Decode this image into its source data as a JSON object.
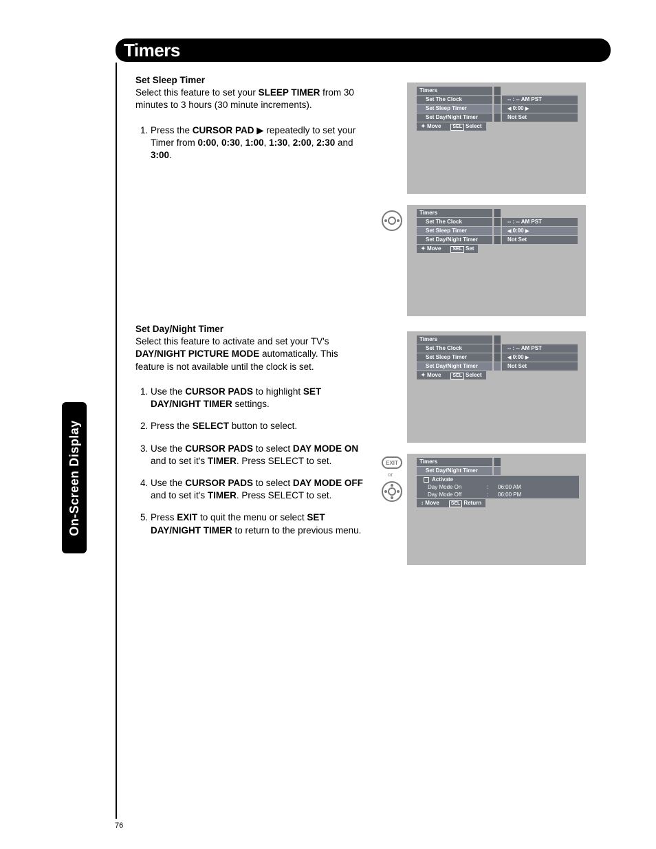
{
  "page": {
    "title": "Timers",
    "number": "76",
    "sideTab": "On-Screen Display"
  },
  "sleep": {
    "heading": "Set Sleep Timer",
    "intro_pre": "Select this feature to set your ",
    "intro_bold": "SLEEP TIMER",
    "intro_post": " from 30 minutes to 3 hours (30 minute increments).",
    "step1_a": "Press the ",
    "step1_b": "CURSOR PAD",
    "step1_c": " ▶ repeatedly to set your Timer from ",
    "t0": "0:00",
    "c1": ", ",
    "t1": "0:30",
    "c2": ", ",
    "t2": "1:00",
    "c3": ", ",
    "t3": "1:30",
    "c4": ", ",
    "t4": "2:00",
    "c5": ", ",
    "t5": "2:30",
    "and": " and ",
    "t6": "3:00",
    "dot": "."
  },
  "daynight": {
    "heading": "Set Day/Night Timer",
    "intro_a": "Select this feature to activate and set your TV's ",
    "intro_b": "DAY/NIGHT PICTURE MODE",
    "intro_c": " automatically. This feature is not available until the clock is set.",
    "s1a": "Use the ",
    "s1b": "CURSOR PADS",
    "s1c": " to highlight ",
    "s1d": "SET DAY/NIGHT TIMER",
    "s1e": " settings.",
    "s2a": "Press the ",
    "s2b": "SELECT",
    "s2c": " button to select.",
    "s3a": "Use the ",
    "s3b": "CURSOR PADS",
    "s3c": " to select ",
    "s3d": "DAY MODE ON",
    "s3e": " and to set it's ",
    "s3f": "TIMER",
    "s3g": ".  Press SELECT to set.",
    "s4a": "Use the ",
    "s4b": "CURSOR PADS",
    "s4c": " to select ",
    "s4d": "DAY MODE OFF",
    "s4e": " and to set it's ",
    "s4f": "TIMER",
    "s4g": ".  Press SELECT to set.",
    "s5a": "Press ",
    "s5b": "EXIT",
    "s5c": " to quit the menu or select ",
    "s5d": "SET DAY/NIGHT TIMER",
    "s5e": " to return to the previous menu."
  },
  "osd": {
    "menuTitle": "Timers",
    "row1": "Set The Clock",
    "row2": "Set Sleep Timer",
    "row3": "Set Day/Night Timer",
    "subTitle": "Set Day/Night Timer",
    "val1": "-- : --  AM PST",
    "val2_l": "◀",
    "val2": " 0:00 ",
    "val2_r": "▶",
    "val3": "Not Set",
    "navMove": "Move",
    "navSelect": "Select",
    "navSet": "Set",
    "navReturn": "Return",
    "sel": "SEL",
    "act": "Activate",
    "dmOn": "Day Mode On",
    "dmOff": "Day Mode Off",
    "dmOnT": "06:00 AM",
    "dmOffT": "06:00 PM",
    "colon": ":"
  },
  "icons": {
    "exit": "EXIT",
    "or": "or"
  }
}
